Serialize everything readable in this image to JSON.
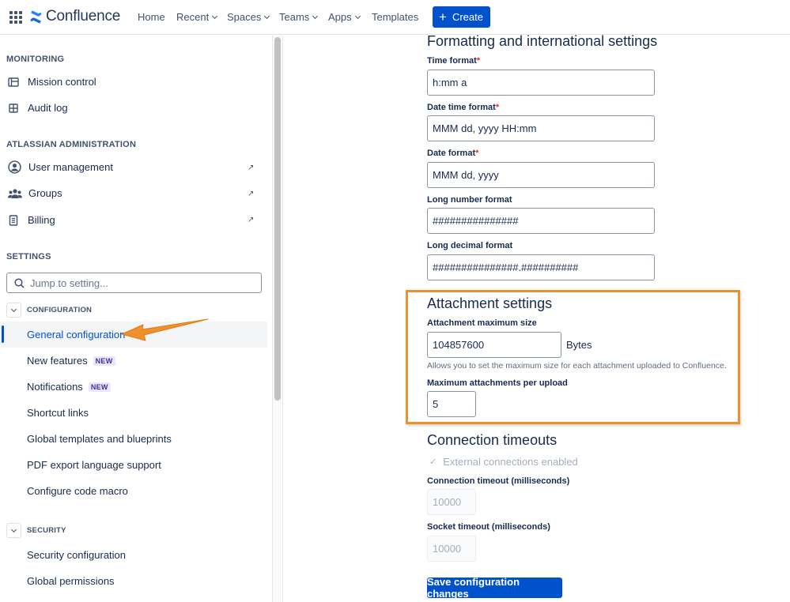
{
  "topnav": {
    "brand": "Confluence",
    "items": [
      {
        "label": "Home",
        "has_dropdown": false
      },
      {
        "label": "Recent",
        "has_dropdown": true
      },
      {
        "label": "Spaces",
        "has_dropdown": true
      },
      {
        "label": "Teams",
        "has_dropdown": true
      },
      {
        "label": "Apps",
        "has_dropdown": true
      },
      {
        "label": "Templates",
        "has_dropdown": false
      }
    ],
    "create_label": "Create"
  },
  "sidebar": {
    "monitoring": {
      "heading": "MONITORING",
      "items": [
        {
          "label": "Mission control",
          "icon": "dashboard-icon"
        },
        {
          "label": "Audit log",
          "icon": "grid-icon"
        }
      ]
    },
    "atlassian_admin": {
      "heading": "ATLASSIAN ADMINISTRATION",
      "items": [
        {
          "label": "User management",
          "icon": "user-icon",
          "external": "↗"
        },
        {
          "label": "Groups",
          "icon": "people-icon",
          "external": "↗"
        },
        {
          "label": "Billing",
          "icon": "receipt-icon",
          "external": "↗"
        }
      ]
    },
    "settings": {
      "heading": "SETTINGS",
      "search_placeholder": "Jump to setting..."
    },
    "configuration": {
      "heading": "CONFIGURATION",
      "items": [
        {
          "label": "General configuration",
          "active": true
        },
        {
          "label": "New features",
          "badge": "NEW"
        },
        {
          "label": "Notifications",
          "badge": "NEW"
        },
        {
          "label": "Shortcut links"
        },
        {
          "label": "Global templates and blueprints"
        },
        {
          "label": "PDF export language support"
        },
        {
          "label": "Configure code macro"
        }
      ]
    },
    "security": {
      "heading": "SECURITY",
      "items": [
        {
          "label": "Security configuration"
        },
        {
          "label": "Global permissions"
        }
      ]
    }
  },
  "main": {
    "formatting": {
      "heading": "Formatting and international settings",
      "fields": [
        {
          "label": "Time format",
          "required": "*",
          "value": "h:mm a"
        },
        {
          "label": "Date time format",
          "required": "*",
          "value": "MMM dd, yyyy HH:mm"
        },
        {
          "label": "Date format",
          "required": "*",
          "value": "MMM dd, yyyy"
        },
        {
          "label": "Long number format",
          "required": "",
          "value": "###############"
        },
        {
          "label": "Long decimal format",
          "required": "",
          "value": "###############.##########"
        }
      ]
    },
    "attachment": {
      "heading": "Attachment settings",
      "max_size_label": "Attachment maximum size",
      "max_size_value": "104857600",
      "max_size_unit": "Bytes",
      "hint": "Allows you to set the maximum size for each attachment uploaded to Confluence.",
      "max_per_upload_label": "Maximum attachments per upload",
      "max_per_upload_value": "5"
    },
    "timeouts": {
      "heading": "Connection timeouts",
      "external_checkbox_label": "External connections enabled",
      "connection_timeout_label": "Connection timeout (milliseconds)",
      "connection_timeout_value": "10000",
      "socket_timeout_label": "Socket timeout (milliseconds)",
      "socket_timeout_value": "10000"
    },
    "save_label": "Save configuration changes"
  },
  "colors": {
    "primary": "#0052cc",
    "annotation": "#f0902c",
    "text": "#172b4d"
  }
}
